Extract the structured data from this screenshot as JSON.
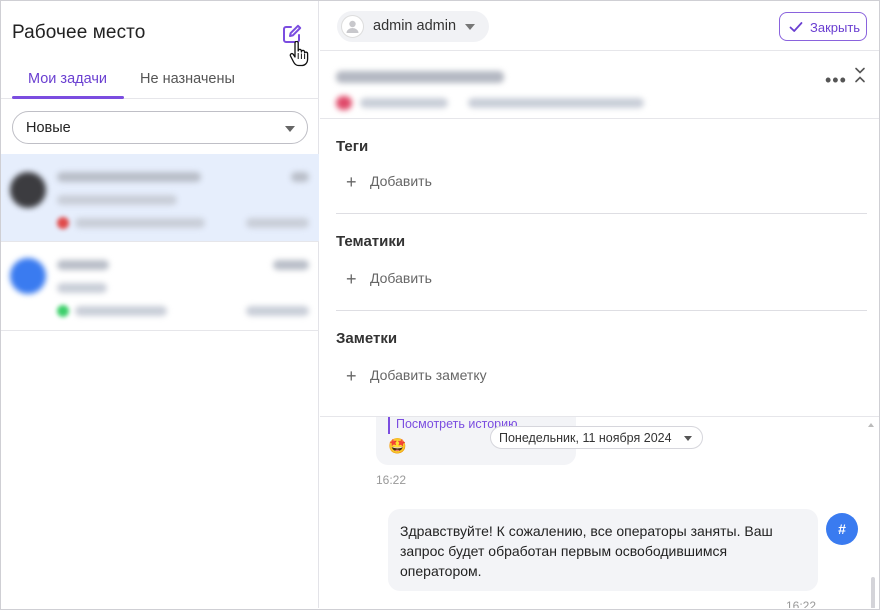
{
  "workspace": {
    "title": "Рабочее место",
    "tabs": [
      {
        "label": "Мои задачи",
        "active": true
      },
      {
        "label": "Не назначены",
        "active": false
      }
    ],
    "filter": {
      "selected": "Новые"
    }
  },
  "tasks": [
    {
      "selected": true,
      "avatar_color": "#3c3c40",
      "status_color": "#e04a4a"
    },
    {
      "selected": false,
      "avatar_color": "#3a7bf0",
      "status_color": "#3ccf6a"
    }
  ],
  "header": {
    "user": "admin admin",
    "close_label": "Закрыть",
    "accent": "#7b4de0"
  },
  "sections": {
    "tags": {
      "title": "Теги",
      "add": "Добавить"
    },
    "topics": {
      "title": "Тематики",
      "add": "Добавить"
    },
    "notes": {
      "title": "Заметки",
      "add": "Добавить заметку"
    }
  },
  "chat": {
    "history_link": "Посмотреть историю",
    "emoji": "🤩",
    "date": "Понедельник, 11 ноября 2024",
    "time1": "16:22",
    "message": "Здравствуйте! К сожалению, все операторы заняты. Ваш запрос будет обработан первым освободившимся оператором.",
    "avatar_symbol": "#",
    "time2": "16:22"
  }
}
